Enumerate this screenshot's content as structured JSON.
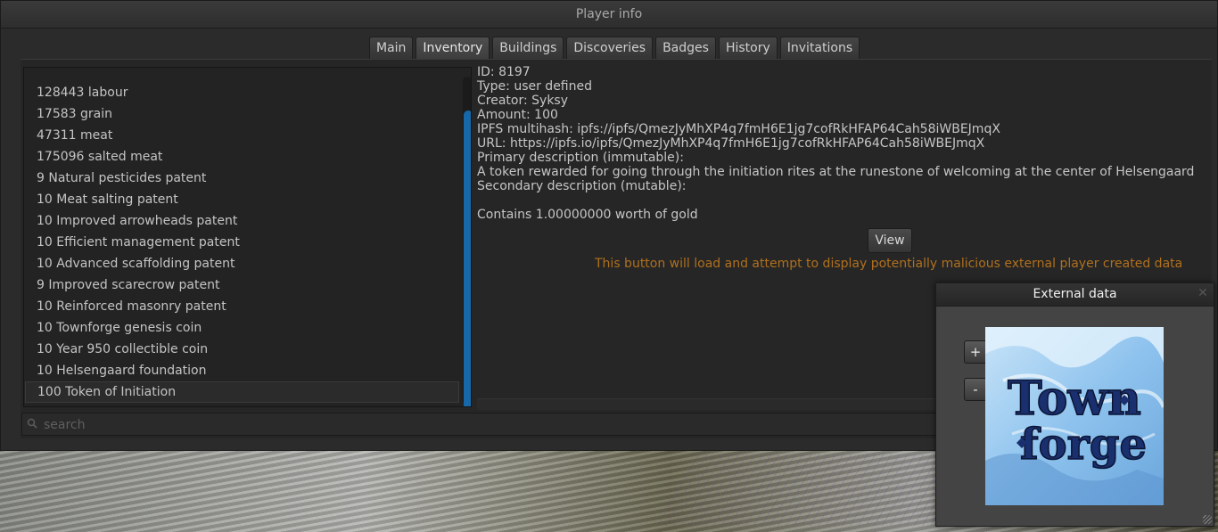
{
  "window": {
    "title": "Player info"
  },
  "tabs": [
    "Main",
    "Inventory",
    "Buildings",
    "Discoveries",
    "Badges",
    "History",
    "Invitations"
  ],
  "active_tab": "Inventory",
  "inventory": [
    "128443 labour",
    "17583 grain",
    "47311 meat",
    "175096 salted meat",
    "9 Natural pesticides patent",
    "10 Meat salting patent",
    "10 Improved arrowheads patent",
    "10 Efficient management patent",
    "10 Advanced scaffolding patent",
    "9 Improved scarecrow patent",
    "10 Reinforced masonry patent",
    "10 Townforge genesis coin",
    "10 Year 950 collectible coin",
    "10 Helsengaard foundation",
    "100 Token of Initiation"
  ],
  "selected_item": "100 Token of Initiation",
  "details": {
    "id": "ID: 8197",
    "type": "Type: user defined",
    "creator": "Creator: Syksy",
    "amount": "Amount: 100",
    "ipfs": "IPFS multihash: ipfs://ipfs/QmezJyMhXP4q7fmH6E1jg7cofRkHFAP64Cah58iWBEJmqX",
    "url": "URL: https://ipfs.io/ipfs/QmezJyMhXP4q7fmH6E1jg7cofRkHFAP64Cah58iWBEJmqX",
    "primary_label": "Primary description (immutable):",
    "primary_text": "A token rewarded for going through the initiation rites at the runestone of welcoming at the center of Helsengaard",
    "secondary_label": "Secondary description (mutable):",
    "contains": "Contains 1.00000000 worth of gold"
  },
  "view_button": "View",
  "warning": "This button will load and attempt to display potentially malicious external player created data",
  "search": {
    "placeholder": "search",
    "value": ""
  },
  "external": {
    "title": "External data",
    "zoom_in": "+",
    "zoom_out": "-",
    "logo_line1": "Town",
    "logo_line2": "forge"
  },
  "colors": {
    "accent": "#1668a8",
    "warning": "#b0701d"
  },
  "icons": {
    "search": "search-icon",
    "close": "close-icon"
  }
}
